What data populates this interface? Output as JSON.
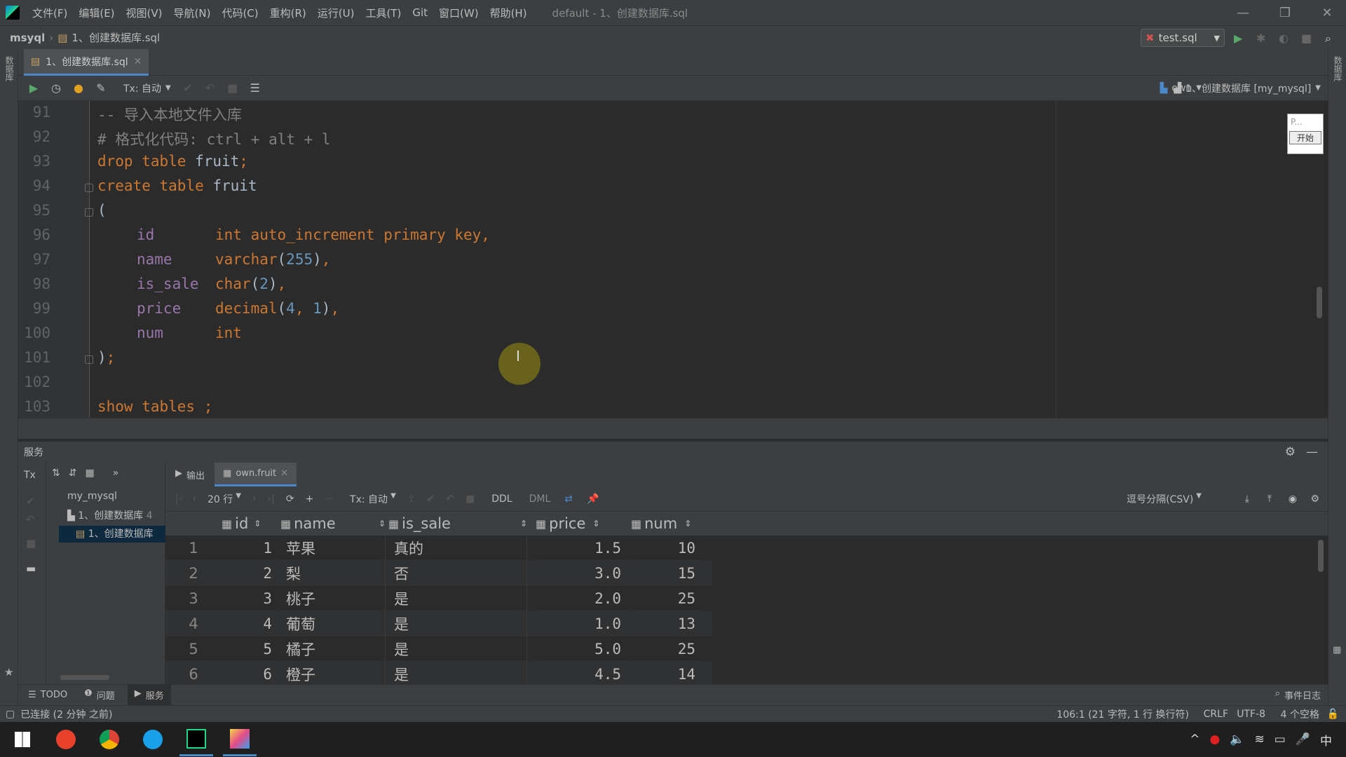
{
  "menu": [
    "文件(F)",
    "编辑(E)",
    "视图(V)",
    "导航(N)",
    "代码(C)",
    "重构(R)",
    "运行(U)",
    "工具(T)",
    "Git",
    "窗口(W)",
    "帮助(H)"
  ],
  "window_title": "default - 1、创建数据库.sql",
  "breadcrumb": {
    "project": "msyql",
    "file": "1、创建数据库.sql"
  },
  "run_config": "test.sql",
  "left_strip_label": "数据库",
  "right_strip_label": "数据库",
  "editor_tab": "1、创建数据库.sql",
  "toolbar": {
    "tx": "Tx: 自动",
    "schema": "own",
    "console": "1、创建数据库 [my_mysql]"
  },
  "minimap": {
    "label": "P...",
    "button": "开始"
  },
  "code": {
    "numbers": [
      "91",
      "92",
      "93",
      "94",
      "95",
      "96",
      "97",
      "98",
      "99",
      "100",
      "101",
      "102",
      "103"
    ],
    "l91": "-- 导入本地文件入库",
    "l92": "# 格式化代码: ctrl + alt + l",
    "drop": "drop table ",
    "tname": "fruit",
    "semi": ";",
    "create": "create table ",
    "paren_open": "(",
    "c_id": "id",
    "t_id": "int auto_increment primary key",
    "c_name": "name",
    "t_name": "varchar",
    "n255": "255",
    "c_sale": "is_sale",
    "t_sale": "char",
    "n2": "2",
    "c_price": "price",
    "t_price": "decimal",
    "n4": "4",
    "n1": "1",
    "c_num": "num",
    "t_num": "int",
    "paren_close": ")",
    "show": "show tables ;"
  },
  "services": {
    "title": "服务",
    "tx": "Tx",
    "tree": [
      "my_mysql",
      "1、创建数据库",
      "1、创建数据库"
    ],
    "tree_count": "4",
    "tabs": [
      "输出",
      "own.fruit"
    ],
    "rows_label": "20 行",
    "tx_mode": "Tx: 自动",
    "ddl": "DDL",
    "dml": "DML",
    "export_format": "逗号分隔(CSV)"
  },
  "grid": {
    "columns": [
      "id",
      "name",
      "is_sale",
      "price",
      "num"
    ],
    "rows": [
      [
        "1",
        "1",
        "苹果",
        "真的",
        "1.5",
        "10"
      ],
      [
        "2",
        "2",
        "梨",
        "否",
        "3.0",
        "15"
      ],
      [
        "3",
        "3",
        "桃子",
        "是",
        "2.0",
        "25"
      ],
      [
        "4",
        "4",
        "葡萄",
        "是",
        "1.0",
        "13"
      ],
      [
        "5",
        "5",
        "橘子",
        "是",
        "5.0",
        "25"
      ],
      [
        "6",
        "6",
        "橙子",
        "是",
        "4.5",
        "14"
      ]
    ]
  },
  "bottom_tabs": [
    "TODO",
    "问题",
    "服务"
  ],
  "event_log": "事件日志",
  "status": {
    "left": "已连接 (2 分钟 之前)",
    "position": "106:1 (21 字符, 1 行 换行符)",
    "eol": "CRLF",
    "enc": "UTF-8",
    "indent": "4 个空格"
  },
  "tray": {
    "ime": "中"
  },
  "colors": {
    "keyword": "#cc7832",
    "comment": "#808080",
    "number": "#6897bb",
    "accent": "#4a88c7"
  }
}
